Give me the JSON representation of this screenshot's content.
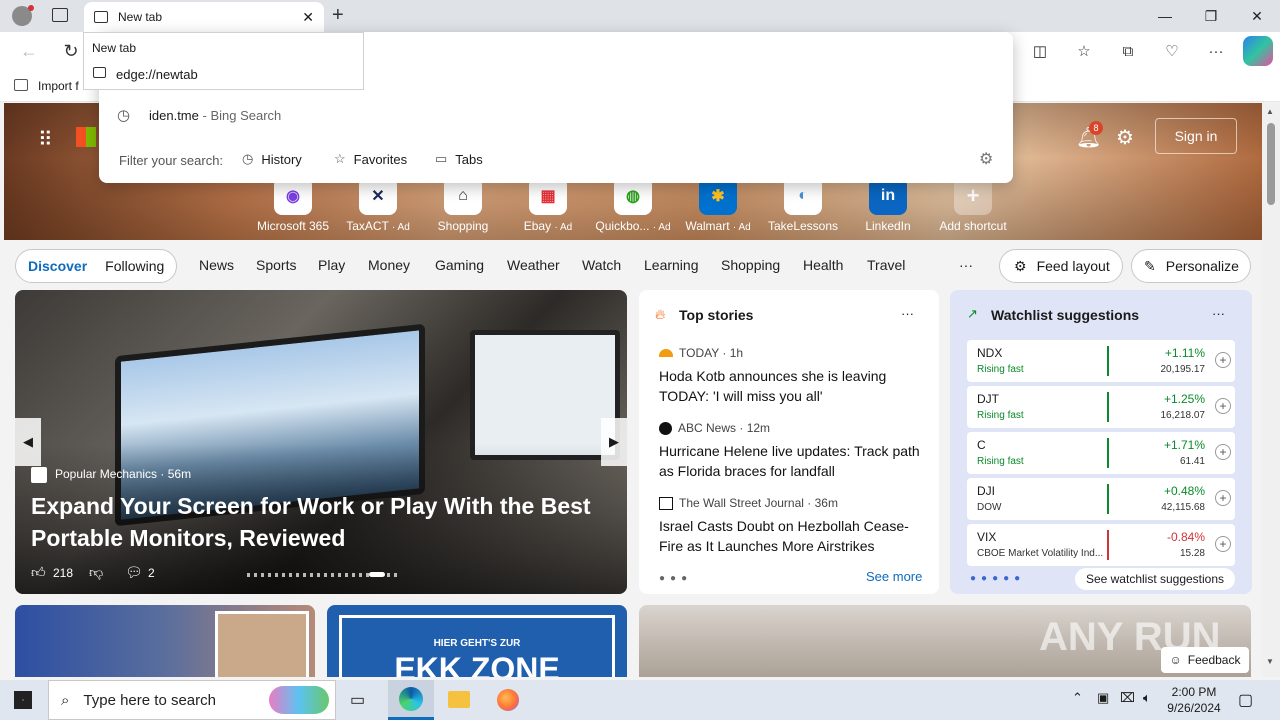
{
  "tab": {
    "title": "New tab"
  },
  "tab_tooltip": {
    "title": "New tab",
    "url": "edge://newtab"
  },
  "favbar": {
    "import_label": "Import f"
  },
  "dropdown": {
    "suggestion_text": "iden.tme",
    "suggestion_suffix": "- Bing Search",
    "filter_label": "Filter your search:",
    "filters": [
      "History",
      "Favorites",
      "Tabs"
    ]
  },
  "header": {
    "notifications_count": "8",
    "signin_label": "Sign in"
  },
  "shortcuts": [
    {
      "label": "Microsoft 365",
      "ad": ""
    },
    {
      "label": "TaxACT",
      "ad": "· Ad"
    },
    {
      "label": "Shopping",
      "ad": ""
    },
    {
      "label": "Ebay",
      "ad": "· Ad"
    },
    {
      "label": "Quickbo...",
      "ad": "· Ad"
    },
    {
      "label": "Walmart",
      "ad": "· Ad"
    },
    {
      "label": "TakeLessons",
      "ad": ""
    },
    {
      "label": "LinkedIn",
      "ad": ""
    },
    {
      "label": "Add shortcut",
      "ad": ""
    }
  ],
  "nav": {
    "discover": "Discover",
    "following": "Following",
    "items": [
      "News",
      "Sports",
      "Play",
      "Money",
      "Gaming",
      "Weather",
      "Watch",
      "Learning",
      "Shopping",
      "Health",
      "Travel"
    ],
    "more": "···",
    "feed_layout": "Feed layout",
    "personalize": "Personalize"
  },
  "hero_story": {
    "source": "Popular Mechanics",
    "age": "· 56m",
    "headline": "Expand Your Screen for Work or Play With the Best Portable Monitors, Reviewed",
    "likes": "218",
    "comments": "2"
  },
  "top_stories": {
    "title": "Top stories",
    "items": [
      {
        "source": "TODAY",
        "age": "· 1h",
        "headline": "Hoda Kotb announces she is leaving TODAY: 'I will miss you all'"
      },
      {
        "source": "ABC News",
        "age": "· 12m",
        "headline": "Hurricane Helene live updates: Track path as Florida braces for landfall"
      },
      {
        "source": "The Wall Street Journal",
        "age": "· 36m",
        "headline": "Israel Casts Doubt on Hezbollah Cease-Fire as It Launches More Airstrikes"
      }
    ],
    "see_more": "See more"
  },
  "watchlist": {
    "title": "Watchlist suggestions",
    "stocks": [
      {
        "symbol": "NDX",
        "sub": "Rising fast",
        "change": "+1.11%",
        "price": "20,195.17",
        "up": true
      },
      {
        "symbol": "DJT",
        "sub": "Rising fast",
        "change": "+1.25%",
        "price": "16,218.07",
        "up": true
      },
      {
        "symbol": "C",
        "sub": "Rising fast",
        "change": "+1.71%",
        "price": "61.41",
        "up": true
      },
      {
        "symbol": "DJI",
        "sub": "DOW",
        "change": "+0.48%",
        "price": "42,115.68",
        "up": true
      },
      {
        "symbol": "VIX",
        "sub": "CBOE Market Volatility Ind...",
        "change": "-0.84%",
        "price": "15.28",
        "up": false
      }
    ],
    "see_more": "See watchlist suggestions"
  },
  "bottom": {
    "ekk_line1": "HIER GEHT'S ZUR",
    "ekk_line2": "EKK ZONE",
    "feedback": "Feedback",
    "watermark": "ANY RUN"
  },
  "taskbar": {
    "search_placeholder": "Type here to search",
    "time": "2:00 PM",
    "date": "9/26/2024"
  },
  "colors": {
    "accent": "#0f6cbd",
    "up": "#0a8a2a",
    "down": "#d13438"
  }
}
